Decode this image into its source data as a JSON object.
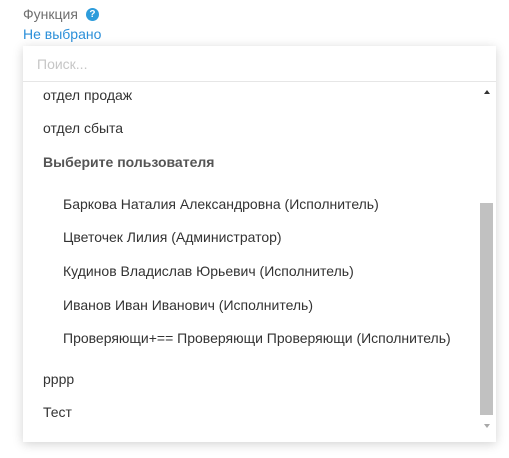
{
  "field": {
    "label": "Функция",
    "help_icon": "?",
    "value": "Не выбрано"
  },
  "search": {
    "placeholder": "Поиск..."
  },
  "options": [
    {
      "label": "отдел продаж",
      "kind": "option"
    },
    {
      "label": "отдел сбыта",
      "kind": "option"
    },
    {
      "label": "Выберите пользователя",
      "kind": "group"
    },
    {
      "label": "Баркова Наталия Александровна (Исполнитель)",
      "kind": "sub"
    },
    {
      "label": "Цветочек Лилия (Администратор)",
      "kind": "sub"
    },
    {
      "label": "Кудинов Владислав Юрьевич (Исполнитель)",
      "kind": "sub"
    },
    {
      "label": "Иванов Иван Иванович (Исполнитель)",
      "kind": "sub"
    },
    {
      "label": "Проверяющи+== Проверяющи Проверяющи (Исполнитель)",
      "kind": "sub"
    },
    {
      "label": "рррр",
      "kind": "option"
    },
    {
      "label": "Тест",
      "kind": "option"
    }
  ],
  "colors": {
    "accent": "#2b8fd9",
    "help_icon": "#2d9cdb",
    "scroll_thumb": "#c1c1c1"
  },
  "icons": {
    "help": "question-circle-icon",
    "scroll_up": "arrow-up-icon",
    "scroll_down": "arrow-down-icon"
  }
}
